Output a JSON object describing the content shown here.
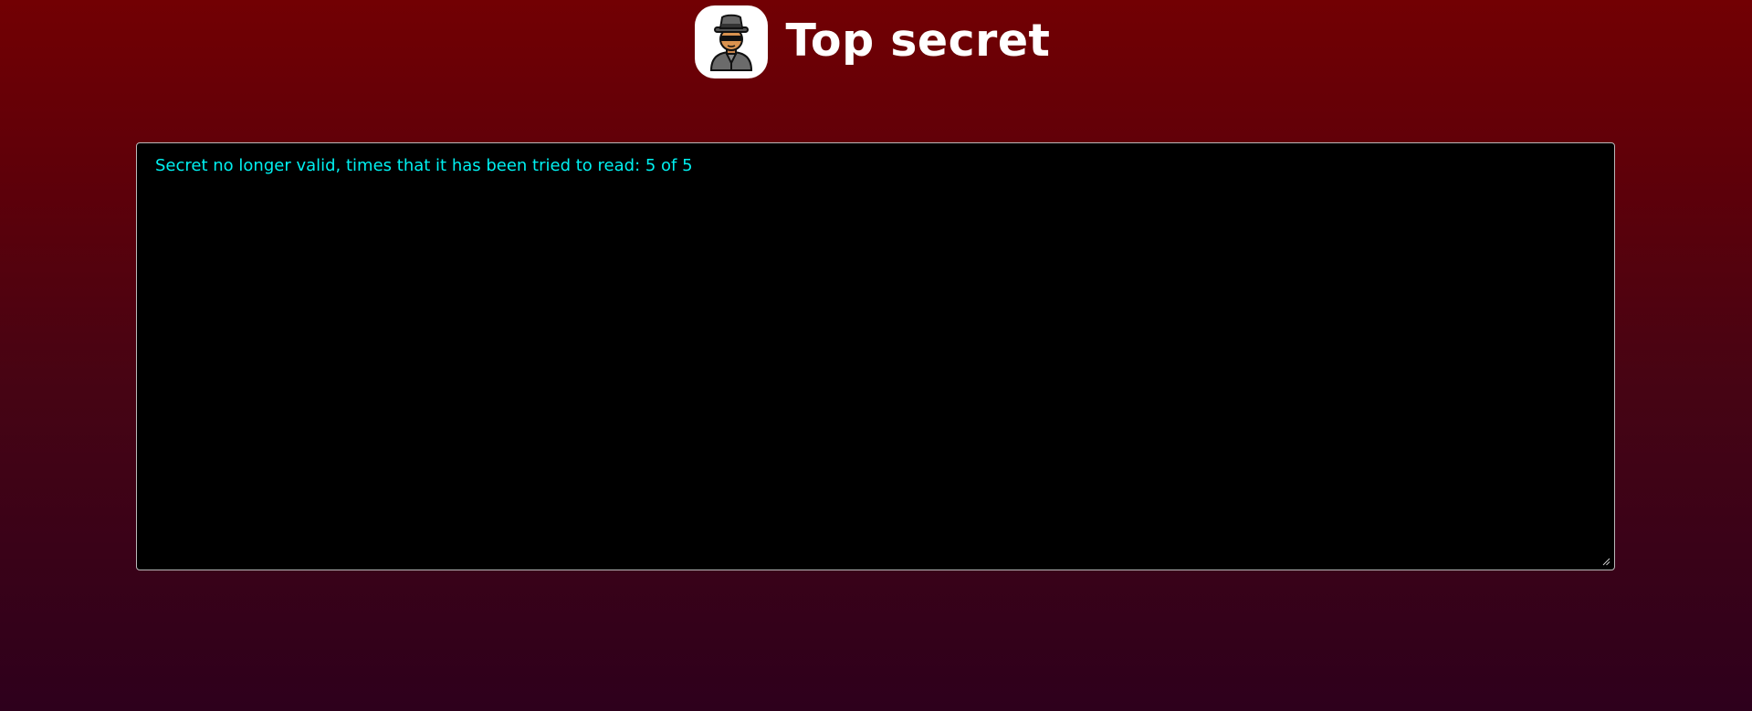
{
  "header": {
    "title": "Top secret",
    "logo_icon": "spy-icon"
  },
  "secret": {
    "message": "Secret no longer valid, times that it has been tried to read: 5 of 5"
  },
  "colors": {
    "background_top": "#720003",
    "background_bottom": "#2e001c",
    "text_accent": "#00f0f0",
    "box_background": "#000000"
  }
}
